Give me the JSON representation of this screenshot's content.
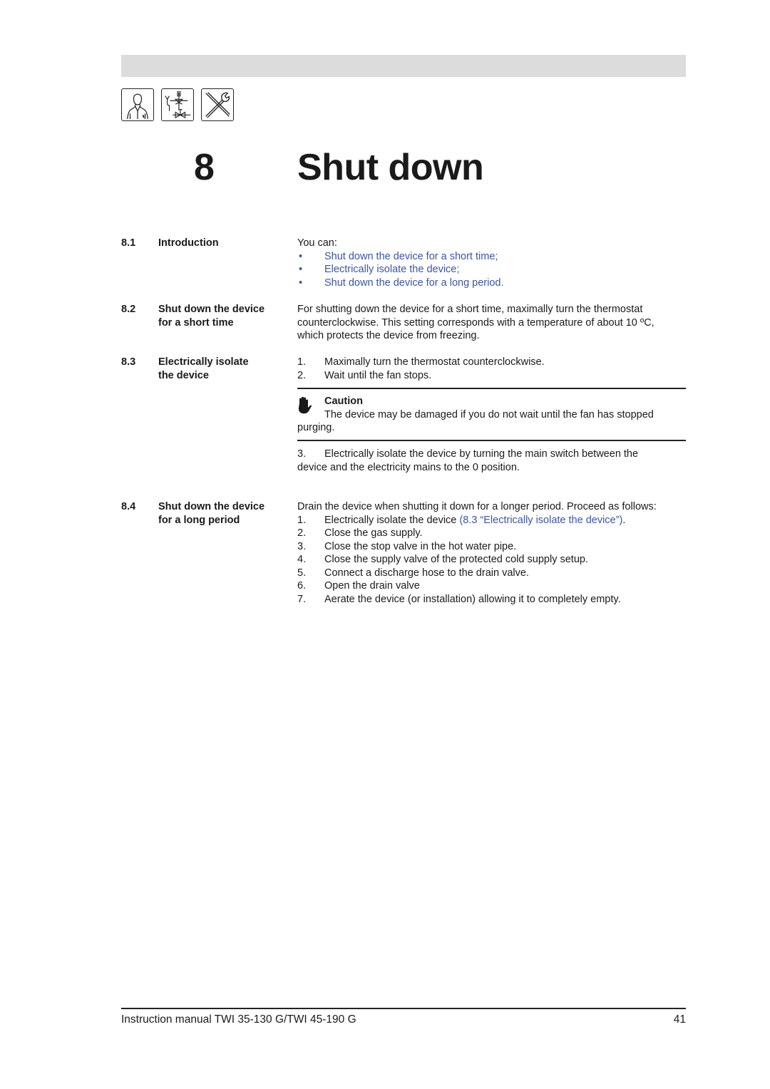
{
  "header": {
    "icons": [
      "user-icon",
      "valve-schematic-icon",
      "tools-icon"
    ]
  },
  "chapter": {
    "number": "8",
    "title": "Shut down"
  },
  "sections": [
    {
      "number": "8.1",
      "title_lines": [
        "Introduction"
      ]
    },
    {
      "number": "8.2",
      "title_lines": [
        "Shut down the device",
        "for a short time"
      ]
    },
    {
      "number": "8.3",
      "title_lines": [
        "Electrically isolate",
        "the device"
      ]
    },
    {
      "number": "8.4",
      "title_lines": [
        "Shut down the device",
        "for a long period"
      ]
    }
  ],
  "intro": {
    "lead": "You can:",
    "bullet": "•",
    "links": [
      "Shut down the device for a short time;",
      "Electrically isolate the device;",
      "Shut down the device for a long period."
    ]
  },
  "short_time": {
    "lines": [
      "For shutting down the device for a short time, maximally turn the thermostat",
      "counterclockwise. This setting corresponds with a temperature of about 10 ºC,",
      "which protects the device from freezing."
    ]
  },
  "isolate": {
    "steps": [
      {
        "n": "1.",
        "text": "Maximally turn the thermostat counterclockwise."
      },
      {
        "n": "2.",
        "text": "Wait until the fan stops."
      }
    ],
    "caution": {
      "icon": "hand-stop-icon",
      "title": "Caution",
      "line1": "The device may be damaged if you do not wait until the fan has stopped",
      "line2": "purging."
    },
    "step3": {
      "n": "3.",
      "line1": "Electrically isolate the device by turning the main switch between the",
      "line2": "device and the electricity mains to the 0 position."
    }
  },
  "long_period": {
    "lead": "Drain the device when shutting it down for a longer period. Proceed as follows:",
    "step1": {
      "n": "1.",
      "text": "Electrically isolate the device ",
      "link": "(8.3 “Electrically isolate the device”)",
      "end": "."
    },
    "steps": [
      {
        "n": "2.",
        "text": "Close the gas supply."
      },
      {
        "n": "3.",
        "text": "Close the stop valve in the hot water pipe."
      },
      {
        "n": "4.",
        "text": "Close the supply valve of the protected cold supply setup."
      },
      {
        "n": "5.",
        "text": "Connect a discharge hose to the drain valve."
      },
      {
        "n": "6.",
        "text": "Open the drain valve"
      },
      {
        "n": "7.",
        "text": "Aerate the device (or installation) allowing it to completely empty."
      }
    ]
  },
  "footer": {
    "manual": "Instruction manual TWI 35-130 G/TWI 45-190 G",
    "page": "41"
  }
}
